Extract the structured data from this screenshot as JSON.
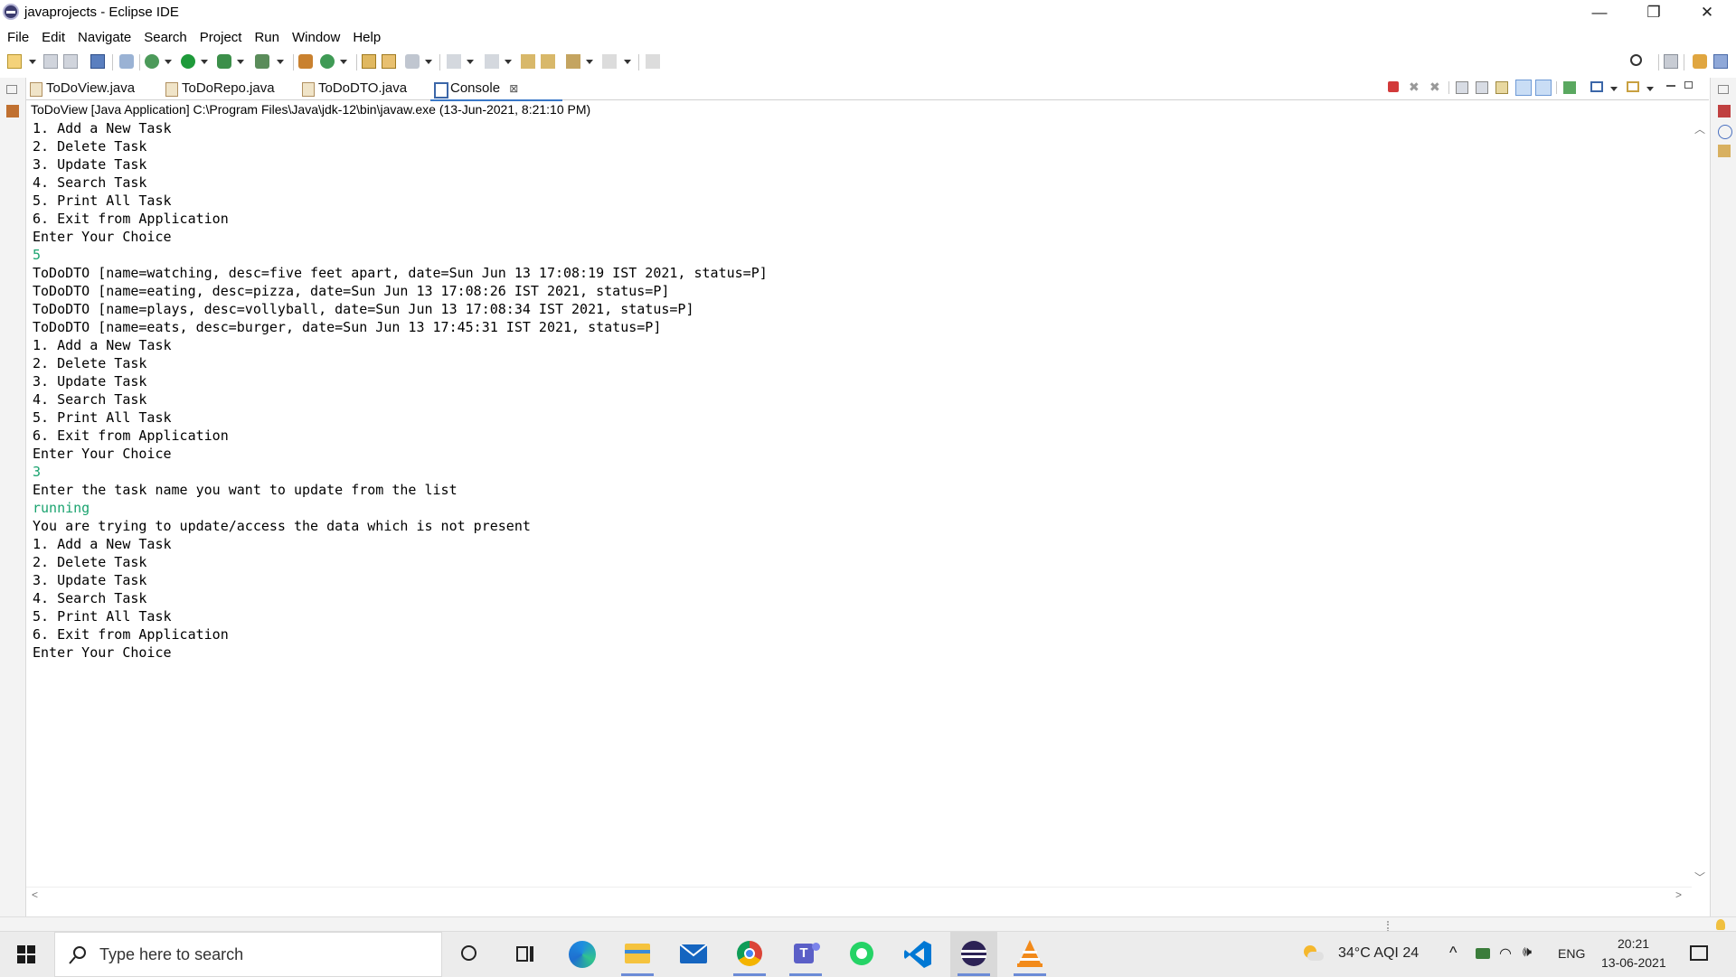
{
  "window": {
    "title": "javaprojects - Eclipse IDE",
    "controls": {
      "minimize": "—",
      "restore": "❐",
      "close": "✕"
    }
  },
  "menu": [
    "File",
    "Edit",
    "Navigate",
    "Search",
    "Project",
    "Run",
    "Window",
    "Help"
  ],
  "tabs": [
    {
      "label": "ToDoView.java",
      "icon": "java-file-icon"
    },
    {
      "label": "ToDoRepo.java",
      "icon": "java-file-icon"
    },
    {
      "label": "ToDoDTO.java",
      "icon": "java-file-icon"
    },
    {
      "label": "Console",
      "icon": "console-icon",
      "active": true,
      "close": "⊠"
    }
  ],
  "console": {
    "launch_info": "ToDoView [Java Application] C:\\Program Files\\Java\\jdk-12\\bin\\javaw.exe  (13-Jun-2021, 8:21:10 PM)",
    "lines": [
      {
        "text": "1. Add a New Task",
        "type": "out"
      },
      {
        "text": "2. Delete Task",
        "type": "out"
      },
      {
        "text": "3. Update Task",
        "type": "out"
      },
      {
        "text": "4. Search Task",
        "type": "out"
      },
      {
        "text": "5. Print All Task",
        "type": "out"
      },
      {
        "text": "6. Exit from Application",
        "type": "out"
      },
      {
        "text": "Enter Your Choice",
        "type": "out"
      },
      {
        "text": "5",
        "type": "input"
      },
      {
        "text": "ToDoDTO [name=watching, desc=five feet apart, date=Sun Jun 13 17:08:19 IST 2021, status=P]",
        "type": "out"
      },
      {
        "text": "ToDoDTO [name=eating, desc=pizza, date=Sun Jun 13 17:08:26 IST 2021, status=P]",
        "type": "out"
      },
      {
        "text": "ToDoDTO [name=plays, desc=vollyball, date=Sun Jun 13 17:08:34 IST 2021, status=P]",
        "type": "out"
      },
      {
        "text": "ToDoDTO [name=eats, desc=burger, date=Sun Jun 13 17:45:31 IST 2021, status=P]",
        "type": "out"
      },
      {
        "text": "1. Add a New Task",
        "type": "out"
      },
      {
        "text": "2. Delete Task",
        "type": "out"
      },
      {
        "text": "3. Update Task",
        "type": "out"
      },
      {
        "text": "4. Search Task",
        "type": "out"
      },
      {
        "text": "5. Print All Task",
        "type": "out"
      },
      {
        "text": "6. Exit from Application",
        "type": "out"
      },
      {
        "text": "Enter Your Choice",
        "type": "out"
      },
      {
        "text": "3",
        "type": "input"
      },
      {
        "text": "Enter the task name you want to update from the list",
        "type": "out"
      },
      {
        "text": "running",
        "type": "input"
      },
      {
        "text": "You are trying to update/access the data which is not present",
        "type": "out"
      },
      {
        "text": "1. Add a New Task",
        "type": "out"
      },
      {
        "text": "2. Delete Task",
        "type": "out"
      },
      {
        "text": "3. Update Task",
        "type": "out"
      },
      {
        "text": "4. Search Task",
        "type": "out"
      },
      {
        "text": "5. Print All Task",
        "type": "out"
      },
      {
        "text": "6. Exit from Application",
        "type": "out"
      },
      {
        "text": "Enter Your Choice",
        "type": "out"
      }
    ]
  },
  "taskbar": {
    "search_placeholder": "Type here to search",
    "apps": [
      "cortana-icon",
      "task-view-icon",
      "edge-icon",
      "file-explorer-icon",
      "mail-icon",
      "chrome-icon",
      "teams-icon",
      "whatsapp-icon",
      "vscode-icon",
      "eclipse-icon",
      "vlc-icon"
    ],
    "weather": "34°C  AQI 24",
    "language": "ENG",
    "time": "20:21",
    "date": "13-06-2021"
  },
  "colors": {
    "console_input": "#1aa36f",
    "active_tab_underline": "#3a78c8",
    "taskbar_bg": "#ececec"
  }
}
